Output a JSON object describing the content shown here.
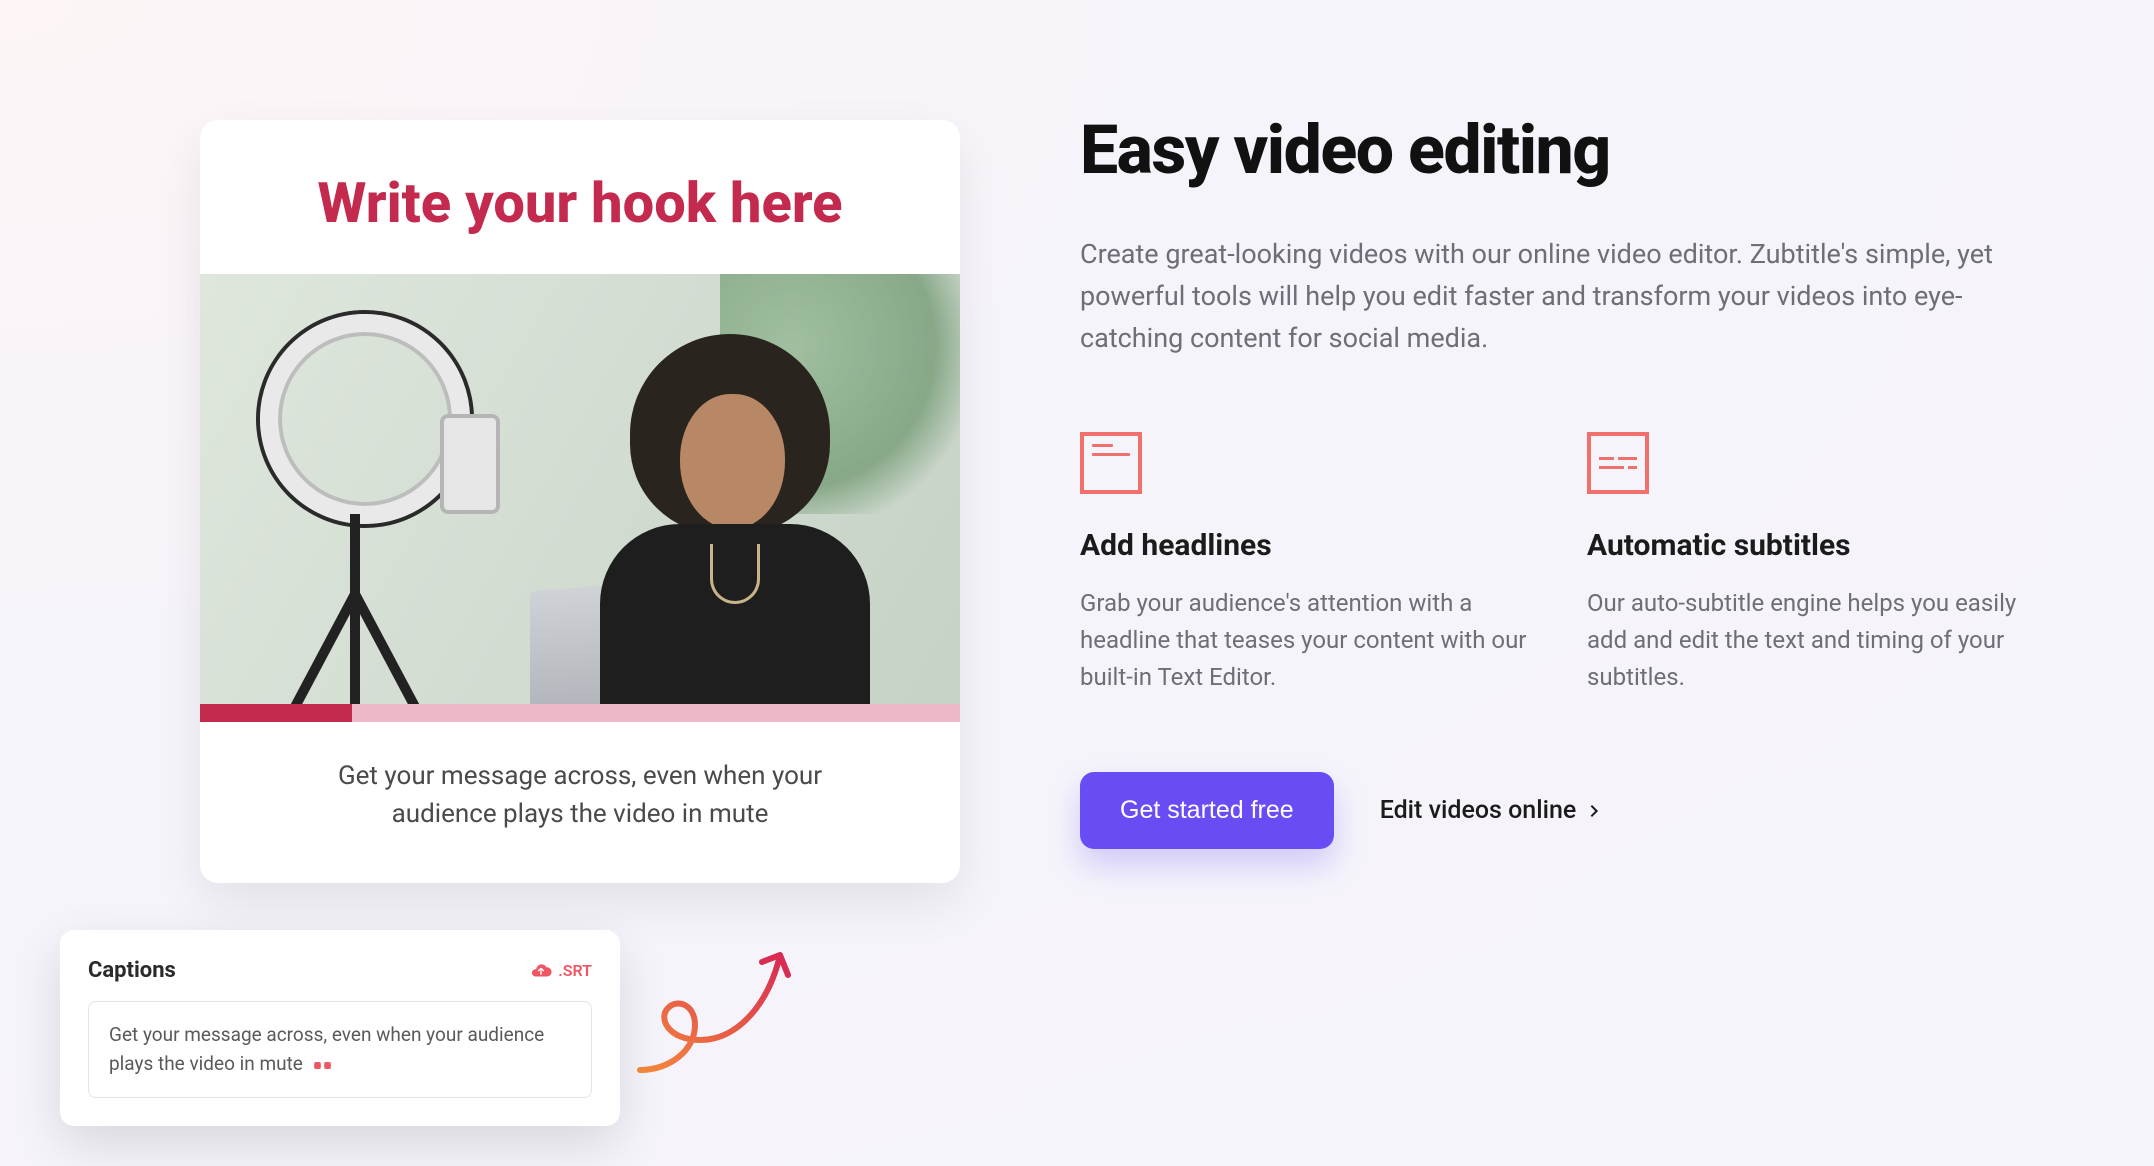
{
  "preview": {
    "hook_title": "Write your hook here",
    "progress_percent": 20,
    "caption_line": "Get your message across, even when your audience plays the video in mute"
  },
  "captions_overlay": {
    "panel_title": "Captions",
    "srt_label": ".SRT",
    "caption_text": "Get your message across, even when your audience plays the video in mute"
  },
  "hero": {
    "title": "Easy video editing",
    "description": "Create great-looking videos with our online video editor. Zubtitle's simple, yet powerful tools will help you edit faster and transform your videos into eye-catching content for social media."
  },
  "features": [
    {
      "title": "Add headlines",
      "description": "Grab your audience's attention with a headline that teases your content with our built-in Text Editor."
    },
    {
      "title": "Automatic subtitles",
      "description": "Our auto-subtitle engine helps you easily add and edit the text and timing of your subtitles."
    }
  ],
  "cta": {
    "primary_label": "Get started free",
    "secondary_label": "Edit videos online"
  }
}
